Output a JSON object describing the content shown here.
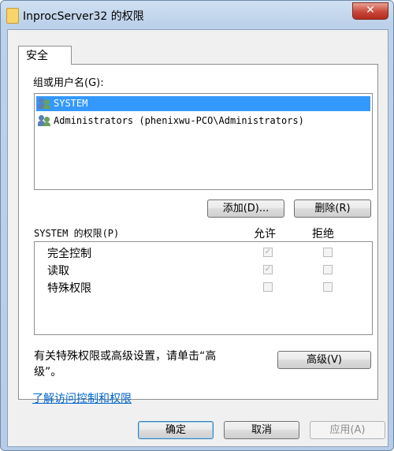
{
  "window": {
    "title": "InprocServer32 的权限",
    "close_symbol": "✕"
  },
  "tabs": [
    {
      "label": "安全"
    }
  ],
  "group_section": {
    "label": "组或用户名(G):",
    "users": [
      {
        "name": "SYSTEM",
        "selected": true
      },
      {
        "name": "Administrators (phenixwu-PCO\\Administrators)",
        "selected": false
      }
    ],
    "add_button": "添加(D)...",
    "remove_button": "删除(R)"
  },
  "permissions": {
    "header_label": "SYSTEM 的权限(P)",
    "allow_header": "允许",
    "deny_header": "拒绝",
    "items": [
      {
        "name": "完全控制",
        "allow": true,
        "deny": false
      },
      {
        "name": "读取",
        "allow": true,
        "deny": false
      },
      {
        "name": "特殊权限",
        "allow": false,
        "deny": false
      }
    ]
  },
  "advanced": {
    "note_line1": "有关特殊权限或高级设置，请单击“高",
    "note_line2": "级”。",
    "button": "高级(V)"
  },
  "link": "了解访问控制和权限",
  "footer": {
    "ok": "确定",
    "cancel": "取消",
    "apply": "应用(A)"
  },
  "check_symbol": "✓",
  "colors": {
    "selection": "#3399ff",
    "link": "#0066cc",
    "close": "#c7473a"
  }
}
